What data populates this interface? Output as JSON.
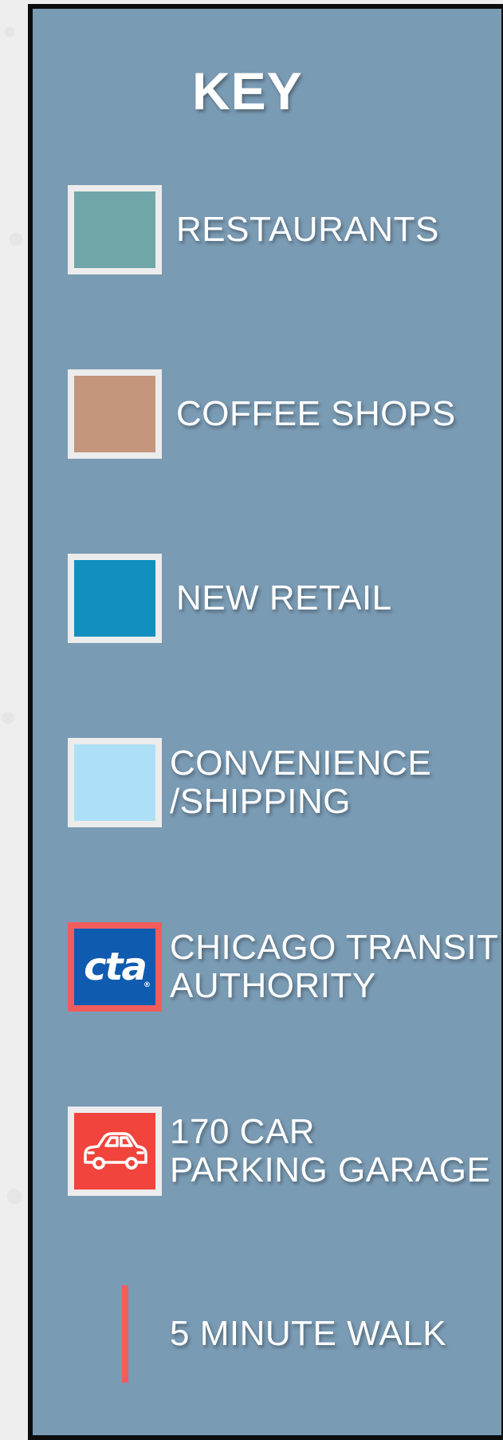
{
  "title": "KEY",
  "colors": {
    "panel_bg": "#7a9bb4",
    "swatch_border": "#ececec",
    "accent_red": "#f25c5c"
  },
  "items": [
    {
      "label_lines": [
        "RESTAURANTS"
      ],
      "swatch_color": "#6fa7a9",
      "icon": ""
    },
    {
      "label_lines": [
        "COFFEE SHOPS"
      ],
      "swatch_color": "#c3957c",
      "icon": ""
    },
    {
      "label_lines": [
        "NEW RETAIL"
      ],
      "swatch_color": "#128fbf",
      "icon": ""
    },
    {
      "label_lines": [
        "CONVENIENCE",
        "/SHIPPING"
      ],
      "swatch_color": "#ade0f7",
      "icon": ""
    },
    {
      "label_lines": [
        "CHICAGO TRANSIT",
        "AUTHORITY"
      ],
      "swatch_color": "#0f5bb0",
      "icon": "cta-logo-icon",
      "logo_text": "cta"
    },
    {
      "label_lines": [
        "170 CAR",
        "PARKING GARAGE"
      ],
      "swatch_color": "#f0443c",
      "icon": "car-icon"
    },
    {
      "label_lines": [
        "5 MINUTE WALK"
      ],
      "swatch_color": "#f25c5c",
      "icon": "walk-line-icon"
    }
  ]
}
